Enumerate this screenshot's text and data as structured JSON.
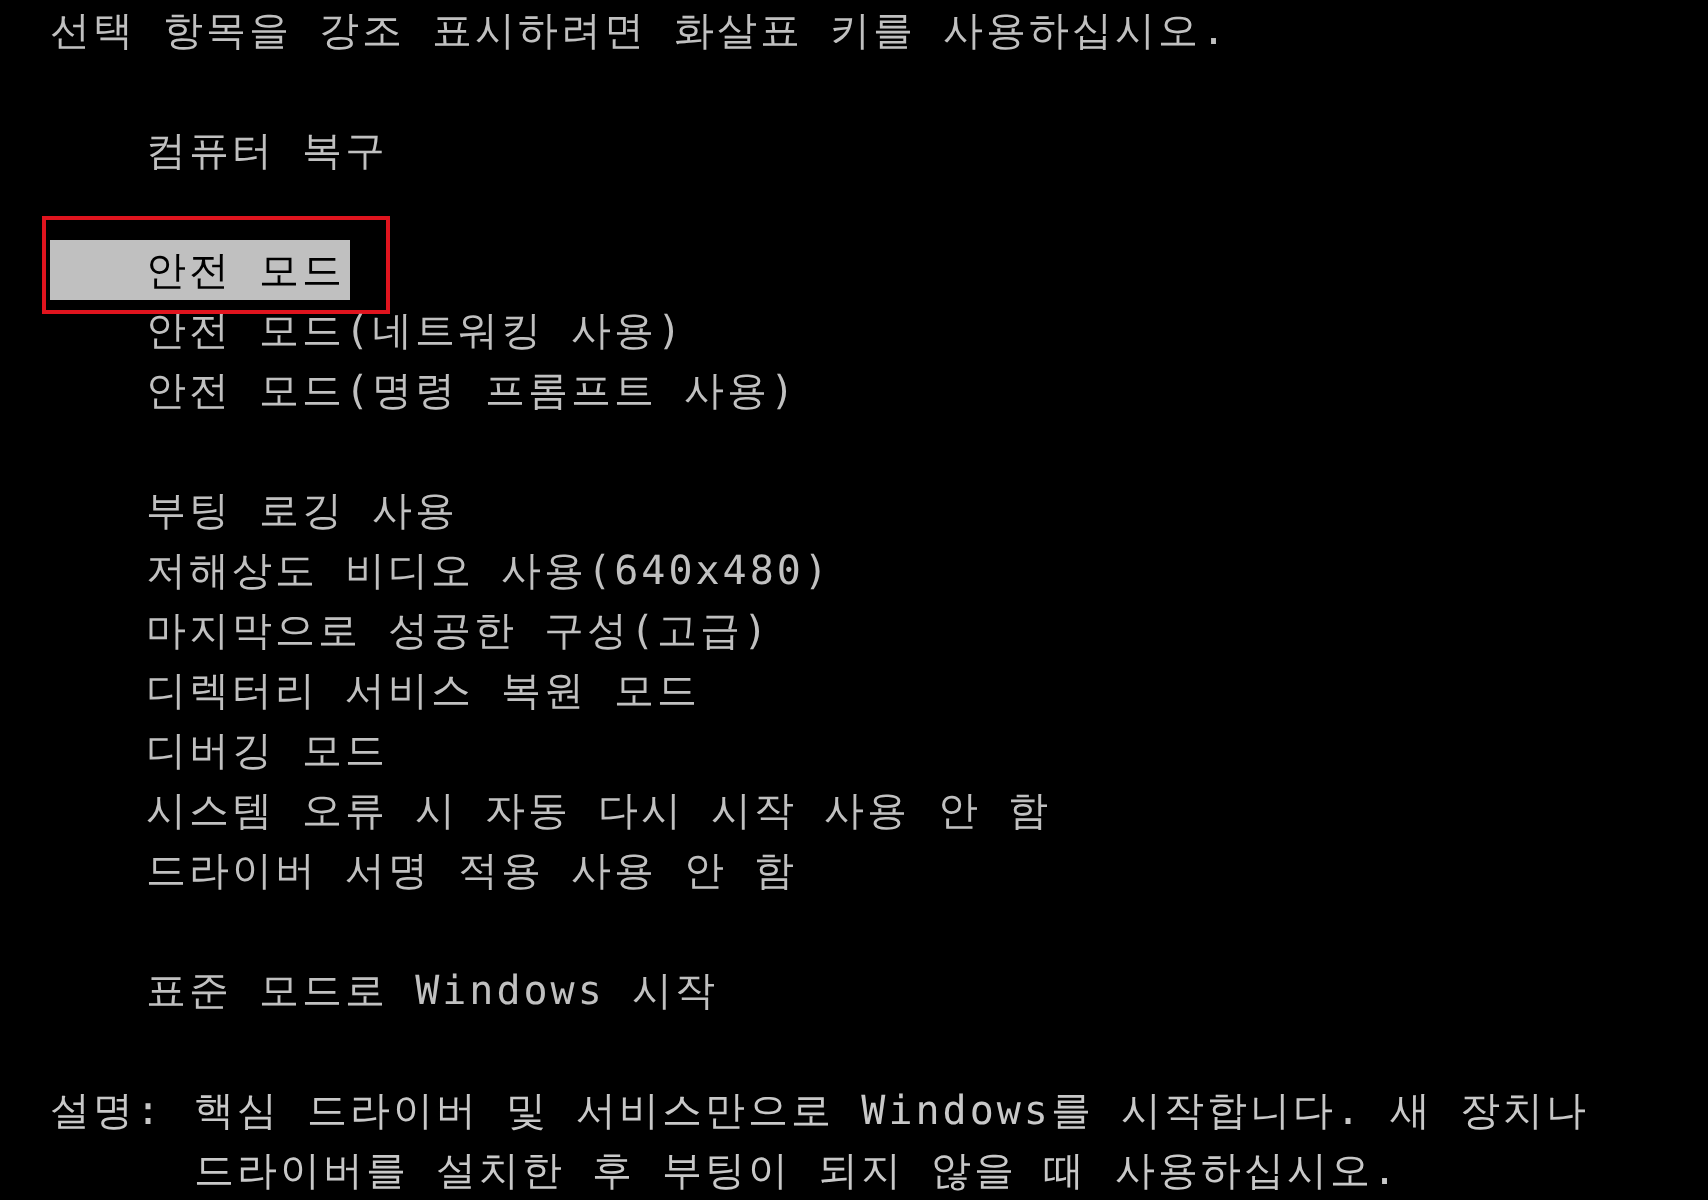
{
  "header": "선택 항목을 강조 표시하려면 화살표 키를 사용하십시오.",
  "groups": [
    {
      "items": [
        {
          "label": "컴퓨터 복구",
          "selected": false
        }
      ]
    },
    {
      "items": [
        {
          "label": "안전 모드",
          "selected": true
        },
        {
          "label": "안전 모드(네트워킹 사용)",
          "selected": false
        },
        {
          "label": "안전 모드(명령 프롬프트 사용)",
          "selected": false
        }
      ]
    },
    {
      "items": [
        {
          "label": "부팅 로깅 사용",
          "selected": false
        },
        {
          "label": "저해상도 비디오 사용(640x480)",
          "selected": false
        },
        {
          "label": "마지막으로 성공한 구성(고급)",
          "selected": false
        },
        {
          "label": "디렉터리 서비스 복원 모드",
          "selected": false
        },
        {
          "label": "디버깅 모드",
          "selected": false
        },
        {
          "label": "시스템 오류 시 자동 다시 시작 사용 안 함",
          "selected": false
        },
        {
          "label": "드라이버 서명 적용 사용 안 함",
          "selected": false
        }
      ]
    },
    {
      "items": [
        {
          "label": "표준 모드로 Windows 시작",
          "selected": false
        }
      ]
    }
  ],
  "description": {
    "label": "설명:",
    "lines": [
      "핵심 드라이버 및 서비스만으로 Windows를 시작합니다. 새 장치나",
      "드라이버를 설치한 후 부팅이 되지 않을 때 사용하십시오."
    ]
  }
}
